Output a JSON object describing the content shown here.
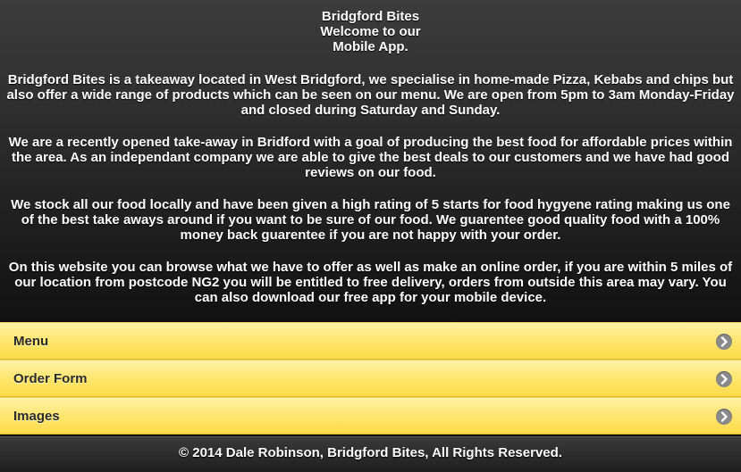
{
  "welcome": {
    "line1": "Bridgford Bites",
    "line2": "Welcome to our",
    "line3": "Mobile App."
  },
  "paragraphs": [
    "Bridgford Bites is a takeaway located in West Bridgford, we specialise in home-made Pizza, Kebabs and chips but also offer a wide range of products which can be seen on our menu. We are open from 5pm to 3am Monday-Friday and closed during Saturday and Sunday.",
    "We are a recently opened take-away in Bridford with a goal of producing the best food for affordable prices within the area. As an independant company we are able to give the best deals to our customers and we have had good reviews on our food.",
    "We stock all our food locally and have been given a high rating of 5 starts for food hygyene rating making us one of the best take aways around if you want to be sure of our food. We guarentee good quality food with a 100% money back guarentee if you are not happy with your order.",
    "On this website you can browse what we have to offer as well as make an online order, if you are within 5 miles of our location from postcode NG2 you will be entitled to free delivery, orders from outside this area may vary. You can also download our free app for your mobile device."
  ],
  "nav": {
    "items": [
      {
        "label": "Menu",
        "icon": "chevron-right-icon"
      },
      {
        "label": "Order Form",
        "icon": "chevron-right-icon"
      },
      {
        "label": "Images",
        "icon": "chevron-right-icon"
      }
    ]
  },
  "footer": {
    "text": "© 2014 Dale Robinson, Bridgford Bites, All Rights Reserved."
  },
  "colors": {
    "nav_background": "#ffe56a",
    "page_background": "#2a2a2a",
    "arrow_circle": "#8a8a8a"
  }
}
